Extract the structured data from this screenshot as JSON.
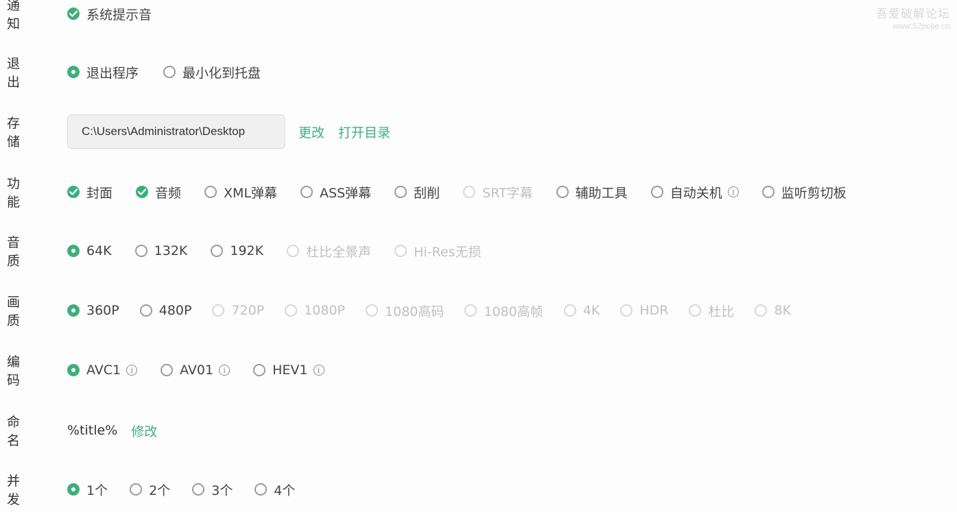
{
  "watermark": {
    "title": "吾爱破解论坛",
    "url": "www.52pojie.cn"
  },
  "notify": {
    "label": "通知",
    "options": [
      {
        "text": "系统提示音",
        "checked": true
      }
    ]
  },
  "exit": {
    "label": "退出",
    "options": [
      {
        "text": "退出程序",
        "checked": true
      },
      {
        "text": "最小化到托盘",
        "checked": false
      }
    ]
  },
  "storage": {
    "label": "存储",
    "path": "C:\\Users\\Administrator\\Desktop",
    "change": "更改",
    "open_dir": "打开目录"
  },
  "features": {
    "label": "功能",
    "options": [
      {
        "text": "封面",
        "checked": true
      },
      {
        "text": "音频",
        "checked": true
      },
      {
        "text": "XML弹幕",
        "checked": false
      },
      {
        "text": "ASS弹幕",
        "checked": false
      },
      {
        "text": "刮削",
        "checked": false
      },
      {
        "text": "SRT字幕",
        "checked": false,
        "disabled": true
      },
      {
        "text": "辅助工具",
        "checked": false
      },
      {
        "text": "自动关机",
        "checked": false,
        "info": true
      },
      {
        "text": "监听剪切板",
        "checked": false
      }
    ]
  },
  "audio_quality": {
    "label": "音质",
    "options": [
      {
        "text": "64K",
        "checked": true
      },
      {
        "text": "132K",
        "checked": false
      },
      {
        "text": "192K",
        "checked": false
      },
      {
        "text": "杜比全景声",
        "checked": false,
        "disabled": true
      },
      {
        "text": "Hi-Res无损",
        "checked": false,
        "disabled": true
      }
    ]
  },
  "video_quality": {
    "label": "画质",
    "options": [
      {
        "text": "360P",
        "checked": true
      },
      {
        "text": "480P",
        "checked": false
      },
      {
        "text": "720P",
        "checked": false,
        "disabled": true
      },
      {
        "text": "1080P",
        "checked": false,
        "disabled": true
      },
      {
        "text": "1080高码",
        "checked": false,
        "disabled": true
      },
      {
        "text": "1080高帧",
        "checked": false,
        "disabled": true
      },
      {
        "text": "4K",
        "checked": false,
        "disabled": true
      },
      {
        "text": "HDR",
        "checked": false,
        "disabled": true
      },
      {
        "text": "杜比",
        "checked": false,
        "disabled": true
      },
      {
        "text": "8K",
        "checked": false,
        "disabled": true
      }
    ]
  },
  "codec": {
    "label": "编码",
    "options": [
      {
        "text": "AVC1",
        "checked": true,
        "info": true
      },
      {
        "text": "AV01",
        "checked": false,
        "info": true
      },
      {
        "text": "HEV1",
        "checked": false,
        "info": true
      }
    ]
  },
  "naming": {
    "label": "命名",
    "value": "%title%",
    "modify": "修改"
  },
  "concurrency": {
    "label": "并发",
    "options": [
      {
        "text": "1个",
        "checked": true
      },
      {
        "text": "2个",
        "checked": false
      },
      {
        "text": "3个",
        "checked": false
      },
      {
        "text": "4个",
        "checked": false
      }
    ]
  },
  "colors": {
    "accent": "#3eaf7c",
    "disabled": "#c0c0c0",
    "text": "#333333"
  },
  "icons": {
    "check": "checkmark-icon",
    "info": "info-icon"
  }
}
